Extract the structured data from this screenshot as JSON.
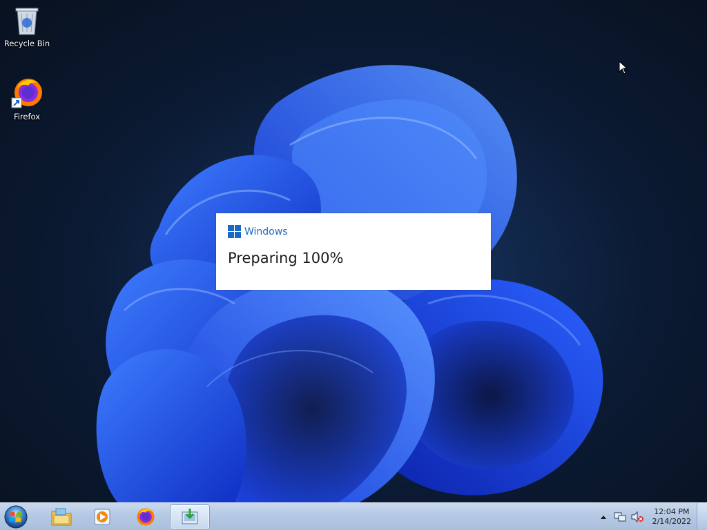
{
  "desktop": {
    "icons": [
      {
        "label": "Recycle Bin",
        "icon": "recycle-bin-icon"
      },
      {
        "label": "Firefox",
        "icon": "firefox-icon"
      }
    ]
  },
  "dialog": {
    "brand": "Windows",
    "status": "Preparing 100%"
  },
  "taskbar": {
    "buttons": [
      {
        "icon": "start-orb-icon"
      },
      {
        "icon": "file-explorer-icon"
      },
      {
        "icon": "media-player-icon"
      },
      {
        "icon": "firefox-icon"
      },
      {
        "icon": "installer-icon",
        "active": true
      }
    ],
    "tray": {
      "icons": [
        "show-hidden-icons-icon",
        "network-icon",
        "volume-muted-icon"
      ],
      "time": "12:04 PM",
      "date": "2/14/2022"
    }
  },
  "colors": {
    "accent": "#1b67c4",
    "wallpaper_bloom": "#1f4ff0"
  }
}
